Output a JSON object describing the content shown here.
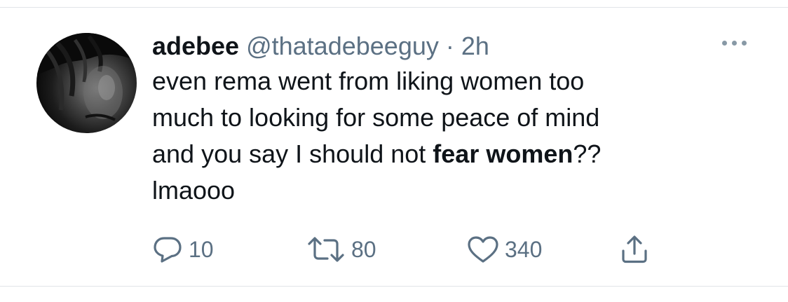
{
  "tweet": {
    "display_name": "adebee",
    "handle": "@thatadebeeguy",
    "separator": "·",
    "time": "2h",
    "text": {
      "line1": "even rema went from liking women too",
      "line2": "much to looking for some peace of mind",
      "line3_pre": "and you say I should not ",
      "line3_bold": "fear women",
      "line3_post": "??",
      "line4": "lmaooo"
    }
  },
  "actions": {
    "replies": "10",
    "retweets": "80",
    "likes": "340"
  },
  "icons": {
    "more": "more-options-icon",
    "reply": "reply-icon",
    "retweet": "retweet-icon",
    "like": "heart-icon",
    "share": "share-icon"
  },
  "colors": {
    "text": "#0f1419",
    "secondary": "#5b7083",
    "divider": "#e1e4e8"
  }
}
